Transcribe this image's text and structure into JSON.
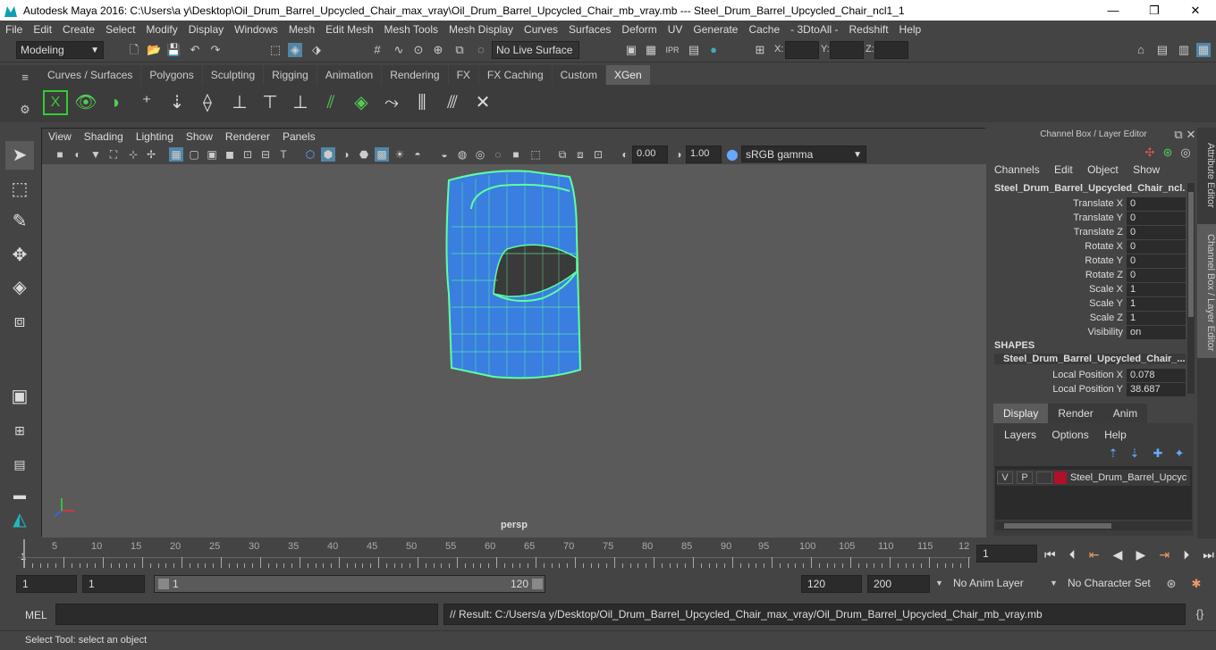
{
  "titlebar": {
    "title": "Autodesk Maya 2016: C:\\Users\\a y\\Desktop\\Oil_Drum_Barrel_Upcycled_Chair_max_vray\\Oil_Drum_Barrel_Upcycled_Chair_mb_vray.mb  ---   Steel_Drum_Barrel_Upcycled_Chair_ncl1_1",
    "minimize": "—",
    "maximize": "❐",
    "close": "✕"
  },
  "menubar": [
    "File",
    "Edit",
    "Create",
    "Select",
    "Modify",
    "Display",
    "Windows",
    "Mesh",
    "Edit Mesh",
    "Mesh Tools",
    "Mesh Display",
    "Curves",
    "Surfaces",
    "Deform",
    "UV",
    "Generate",
    "Cache",
    "- 3DtoAll -",
    "Redshift",
    "Help"
  ],
  "statusline": {
    "mode": "Modeling",
    "live_surface": "No Live Surface",
    "x_label": "X:",
    "y_label": "Y:",
    "z_label": "Z:"
  },
  "shelf": {
    "tabs": [
      "Curves / Surfaces",
      "Polygons",
      "Sculpting",
      "Rigging",
      "Animation",
      "Rendering",
      "FX",
      "FX Caching",
      "Custom",
      "XGen"
    ],
    "active": "XGen"
  },
  "viewport": {
    "menu": [
      "View",
      "Shading",
      "Lighting",
      "Show",
      "Renderer",
      "Panels"
    ],
    "exposure": "0.00",
    "gamma": "1.00",
    "color_space": "sRGB gamma",
    "camera": "persp"
  },
  "channelbox": {
    "header": "Channel Box / Layer Editor",
    "menus": [
      "Channels",
      "Edit",
      "Object",
      "Show"
    ],
    "object": "Steel_Drum_Barrel_Upcycled_Chair_ncl...",
    "attributes": [
      {
        "name": "Translate X",
        "value": "0"
      },
      {
        "name": "Translate Y",
        "value": "0"
      },
      {
        "name": "Translate Z",
        "value": "0"
      },
      {
        "name": "Rotate X",
        "value": "0"
      },
      {
        "name": "Rotate Y",
        "value": "0"
      },
      {
        "name": "Rotate Z",
        "value": "0"
      },
      {
        "name": "Scale X",
        "value": "1"
      },
      {
        "name": "Scale Y",
        "value": "1"
      },
      {
        "name": "Scale Z",
        "value": "1"
      },
      {
        "name": "Visibility",
        "value": "on"
      }
    ],
    "shapes_label": "SHAPES",
    "shape_name": "Steel_Drum_Barrel_Upcycled_Chair_...",
    "shape_attributes": [
      {
        "name": "Local Position X",
        "value": "0.078"
      },
      {
        "name": "Local Position Y",
        "value": "38.687"
      }
    ]
  },
  "sidetabs": {
    "attribute_editor": "Attribute Editor",
    "channel_box": "Channel Box / Layer Editor"
  },
  "layers": {
    "tabs": [
      "Display",
      "Render",
      "Anim"
    ],
    "active": "Display",
    "menus": [
      "Layers",
      "Options",
      "Help"
    ],
    "row": {
      "v": "V",
      "p": "P",
      "name": "Steel_Drum_Barrel_Upcyc",
      "color": "#b0102a"
    }
  },
  "timeline": {
    "labels": [
      "5",
      "10",
      "15",
      "20",
      "25",
      "30",
      "35",
      "40",
      "45",
      "50",
      "55",
      "60",
      "65",
      "70",
      "75",
      "80",
      "85",
      "90",
      "95",
      "100",
      "105",
      "110",
      "115",
      "12"
    ],
    "start_marker": "1",
    "current_frame": "1"
  },
  "range": {
    "start": "1",
    "playback_start": "1",
    "slider_start": "1",
    "slider_end": "120",
    "playback_end": "120",
    "end": "200",
    "anim_layer": "No Anim Layer",
    "character_set": "No Character Set"
  },
  "cmdline": {
    "label": "MEL",
    "result": "// Result: C:/Users/a y/Desktop/Oil_Drum_Barrel_Upcycled_Chair_max_vray/Oil_Drum_Barrel_Upcycled_Chair_mb_vray.mb"
  },
  "helpline": "Select Tool: select an object",
  "colors": {
    "accent": "#5285a6",
    "wire": "#5fffa0",
    "mesh": "#3a7ee0"
  }
}
